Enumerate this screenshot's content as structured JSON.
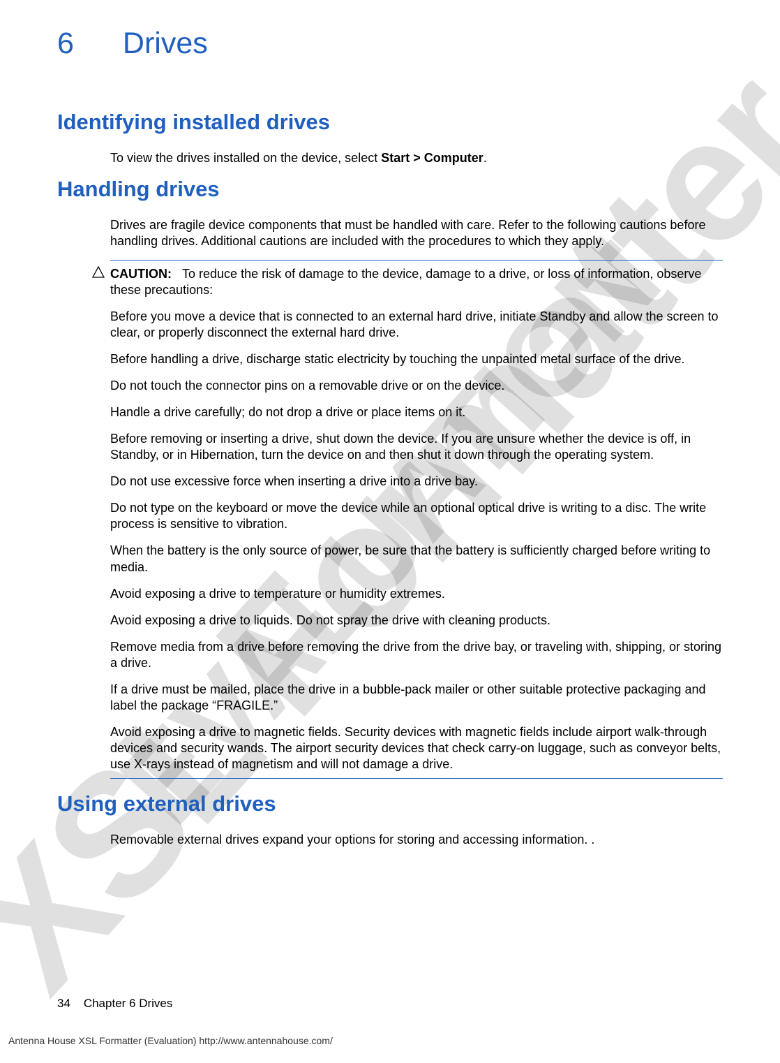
{
  "watermark1": "XSL Formatter",
  "watermark2": "EVALUATION",
  "chapter": {
    "number": "6",
    "title": "Drives"
  },
  "section1": {
    "title": "Identifying installed drives",
    "text_pre": "To view the drives installed on the device, select ",
    "text_bold": "Start > Computer",
    "text_post": "."
  },
  "section2": {
    "title": "Handling drives",
    "intro": "Drives are fragile device components that must be handled with care. Refer to the following cautions before handling drives. Additional cautions are included with the procedures to which they apply.",
    "caution_label": "CAUTION:",
    "caution_first": "To reduce the risk of damage to the device, damage to a drive, or loss of information, observe these precautions:",
    "paragraphs": [
      "Before you move a device that is connected to an external hard drive, initiate Standby and allow the screen to clear, or properly disconnect the external hard drive.",
      "Before handling a drive, discharge static electricity by touching the unpainted metal surface of the drive.",
      "Do not touch the connector pins on a removable drive or on the device.",
      "Handle a drive carefully; do not drop a drive or place items on it.",
      "Before removing or inserting a drive, shut down the device. If you are unsure whether the device is off, in Standby, or in Hibernation, turn the device on and then shut it down through the operating system.",
      "Do not use excessive force when inserting a drive into a drive bay.",
      "Do not type on the keyboard or move the device while an optional optical drive is writing to a disc. The write process is sensitive to vibration.",
      "When the battery is the only source of power, be sure that the battery is sufficiently charged before writing to media.",
      "Avoid exposing a drive to temperature or humidity extremes.",
      "Avoid exposing a drive to liquids. Do not spray the drive with cleaning products.",
      "Remove media from a drive before removing the drive from the drive bay, or traveling with, shipping, or storing a drive.",
      "If a drive must be mailed, place the drive in a bubble-pack mailer or other suitable protective packaging and label the package “FRAGILE.”",
      "Avoid exposing a drive to magnetic fields. Security devices with magnetic fields include airport walk-through devices and security wands. The airport security devices that check carry-on luggage, such as conveyor belts, use X-rays instead of magnetism and will not damage a drive."
    ]
  },
  "section3": {
    "title": "Using external drives",
    "text": "Removable external drives expand your options for storing and accessing information. ."
  },
  "footer": {
    "page": "34",
    "label": "Chapter 6   Drives"
  },
  "eval_footer": "Antenna House XSL Formatter (Evaluation)  http://www.antennahouse.com/"
}
